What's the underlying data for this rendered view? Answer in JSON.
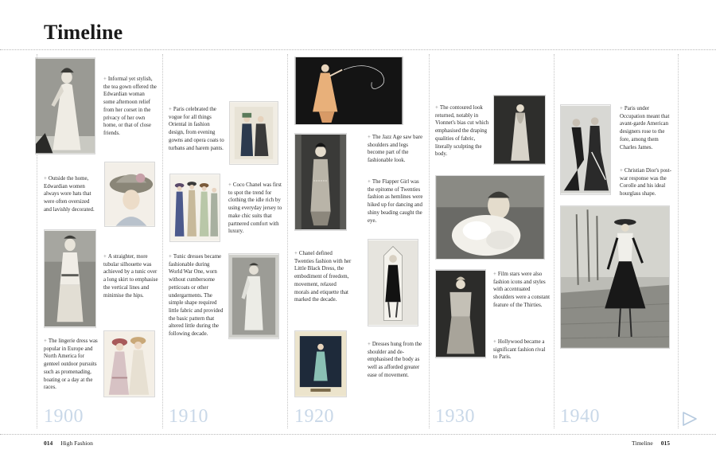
{
  "page": {
    "title": "Timeline",
    "footer_left_number": "014",
    "footer_left_label": "High Fashion",
    "footer_right_label": "Timeline",
    "footer_right_number": "015"
  },
  "decades": [
    {
      "year": "1900",
      "entries": [
        "Informal yet stylish, the tea gown offered the Edwardian woman some afternoon relief from her corset in the privacy of her own home, or that of close friends.",
        "Outside the home, Edwardian women always wore hats that were often oversized and lavishly decorated.",
        "A straighter, more tubular silhouette was achieved by a tunic over a long skirt to emphasise the vertical lines and minimise the hips.",
        "The lingerie dress was popular in Europe and North America for genteel outdoor pursuits such as promenading, boating or a day at the races."
      ]
    },
    {
      "year": "1910",
      "entries": [
        "Paris celebrated the vogue for all things Oriental in fashion design, from evening gowns and opera coats to turbans and harem pants.",
        "Coco Chanel was first to spot the trend for clothing the idle rich by using everyday jersey to make chic suits that partnered comfort with luxury.",
        "Tunic dresses became fashionable during World War One, worn without cumbersome petticoats or other undergarments. The simple shape required little fabric and provided the basic pattern that altered little during the following decade."
      ]
    },
    {
      "year": "1920",
      "entries": [
        "The Jazz Age saw bare shoulders and legs become part of the fashionable look.",
        "The Flapper Girl was the epitome of Twenties fashion as hemlines were hiked up for dancing and shiny beading caught the eye.",
        "Chanel defined Twenties fashion with her Little Black Dress, the embodiment of freedom, movement, relaxed morals and etiquette that marked the decade.",
        "Dresses hung from the shoulder and de-emphasised the body as well as afforded greater ease of movement."
      ]
    },
    {
      "year": "1930",
      "entries": [
        "The contoured look returned, notably in Vionnet's bias cut which emphasised the draping qualities of fabric, literally sculpting the body.",
        "Film stars were also fashion icons and styles with accentuated shoulders were a constant feature of the Thirties.",
        "Hollywood became a significant fashion rival to Paris."
      ]
    },
    {
      "year": "1940",
      "entries": [
        "Paris under Occupation meant that avant-garde American designers rose to the fore, among them Charles James.",
        "Christian Dior's post-war response was the Corolle and his ideal hourglass shape."
      ]
    }
  ],
  "images": [
    {
      "id": "tea-gown",
      "kind": "bw",
      "subject": "standing"
    },
    {
      "id": "hat",
      "kind": "color",
      "subject": "hat"
    },
    {
      "id": "tunic-skirt",
      "kind": "bw",
      "subject": "standing"
    },
    {
      "id": "lingerie-dress",
      "kind": "color",
      "subject": "pair"
    },
    {
      "id": "oriental",
      "kind": "color",
      "subject": "pair"
    },
    {
      "id": "chanel-suits",
      "kind": "color",
      "subject": "group"
    },
    {
      "id": "tunic-dress",
      "kind": "bw",
      "subject": "standing"
    },
    {
      "id": "jazz-age",
      "kind": "dark",
      "subject": "standing"
    },
    {
      "id": "flapper",
      "kind": "bw",
      "subject": "standing"
    },
    {
      "id": "little-black-dress",
      "kind": "bw",
      "subject": "black-dress"
    },
    {
      "id": "twenties-gown",
      "kind": "color",
      "subject": "standing"
    },
    {
      "id": "bias-cut",
      "kind": "bw",
      "subject": "standing"
    },
    {
      "id": "ruffle-portrait",
      "kind": "bw",
      "subject": "portrait"
    },
    {
      "id": "film-star",
      "kind": "bw",
      "subject": "standing"
    },
    {
      "id": "charles-james",
      "kind": "bw",
      "subject": "pair"
    },
    {
      "id": "dior-new-look",
      "kind": "bw",
      "subject": "new-look"
    }
  ]
}
